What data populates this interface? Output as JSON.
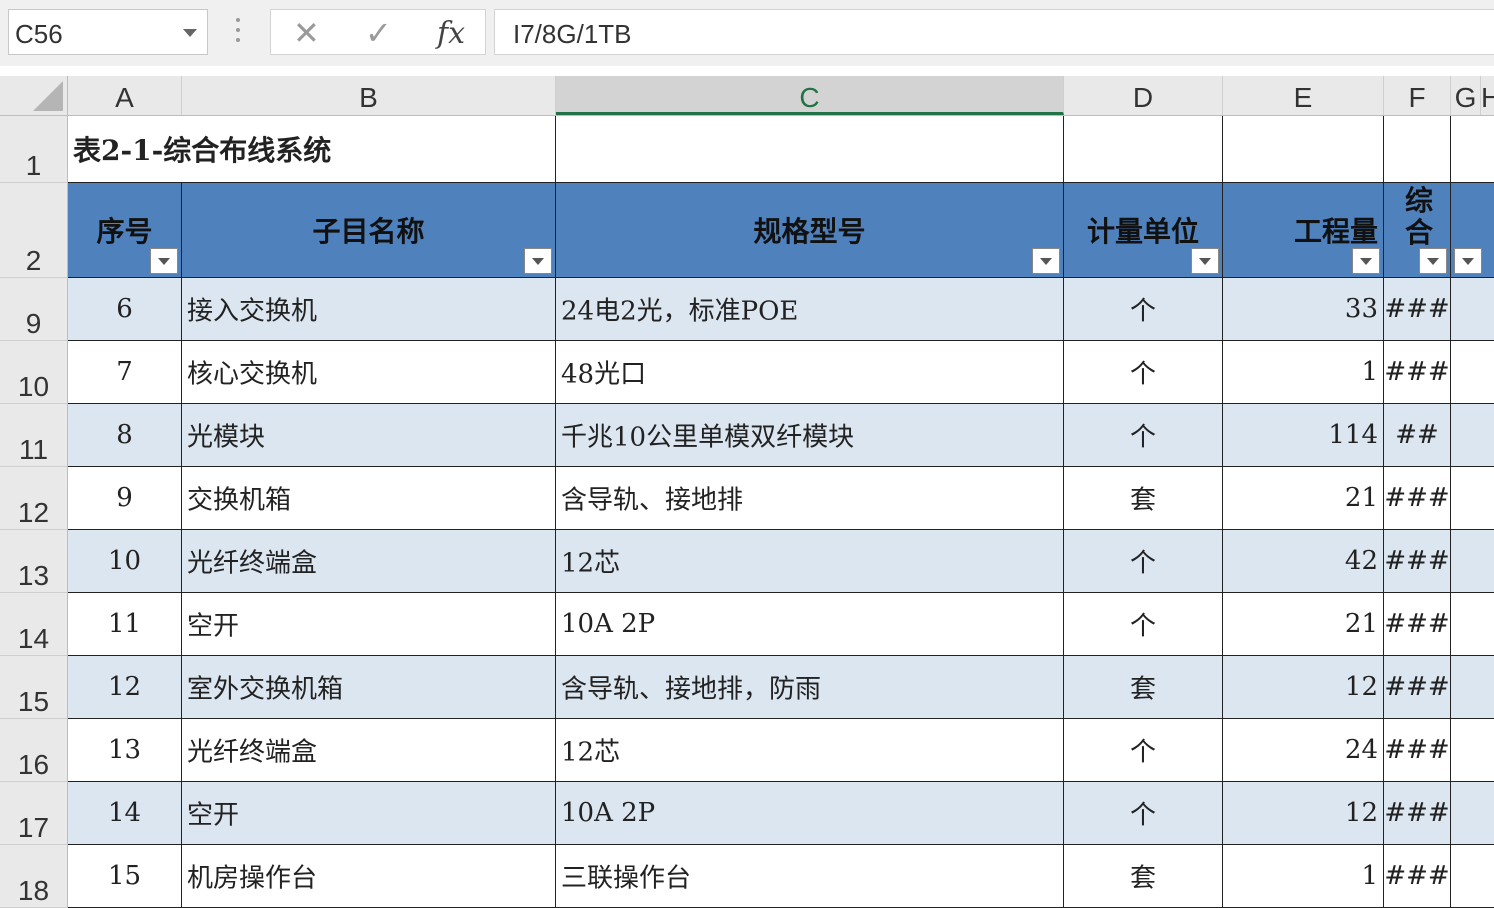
{
  "formula_bar": {
    "name_box": "C56",
    "cancel_icon": "✕",
    "enter_icon": "✓",
    "fx_label": "fx",
    "formula_value": "I7/8G/1TB"
  },
  "columns": [
    "A",
    "B",
    "C",
    "D",
    "E",
    "F",
    "G",
    "H"
  ],
  "selected_column": "C",
  "title": "表2-1-综合布线系统",
  "headers": {
    "seq": "序号",
    "name": "子目名称",
    "spec": "规格型号",
    "unit": "计量单位",
    "qty": "工程量",
    "f": "综合"
  },
  "rows": [
    {
      "row": "9",
      "seq": "6",
      "name": "接入交换机",
      "spec": "24电2光，标准POE",
      "unit": "个",
      "qty": "33",
      "f": "###"
    },
    {
      "row": "10",
      "seq": "7",
      "name": "核心交换机",
      "spec": "48光口",
      "unit": "个",
      "qty": "1",
      "f": "###"
    },
    {
      "row": "11",
      "seq": "8",
      "name": "光模块",
      "spec": "千兆10公里单模双纤模块",
      "unit": "个",
      "qty": "114",
      "f": "##"
    },
    {
      "row": "12",
      "seq": "9",
      "name": "交换机箱",
      "spec": "含导轨、接地排",
      "unit": "套",
      "qty": "21",
      "f": "###"
    },
    {
      "row": "13",
      "seq": "10",
      "name": "光纤终端盒",
      "spec": "12芯",
      "unit": "个",
      "qty": "42",
      "f": "###"
    },
    {
      "row": "14",
      "seq": "11",
      "name": "空开",
      "spec": "10A 2P",
      "unit": "个",
      "qty": "21",
      "f": "###"
    },
    {
      "row": "15",
      "seq": "12",
      "name": "室外交换机箱",
      "spec": "含导轨、接地排，防雨",
      "unit": "套",
      "qty": "12",
      "f": "###"
    },
    {
      "row": "16",
      "seq": "13",
      "name": "光纤终端盒",
      "spec": "12芯",
      "unit": "个",
      "qty": "24",
      "f": "###"
    },
    {
      "row": "17",
      "seq": "14",
      "name": "空开",
      "spec": "10A 2P",
      "unit": "个",
      "qty": "12",
      "f": "###"
    },
    {
      "row": "18",
      "seq": "15",
      "name": "机房操作台",
      "spec": "三联操作台",
      "unit": "套",
      "qty": "1",
      "f": "###"
    }
  ],
  "row_labels": {
    "r1": "1",
    "r2": "2"
  }
}
